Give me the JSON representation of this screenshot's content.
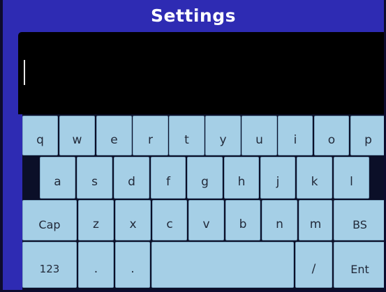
{
  "title": "Settings",
  "text_field": {
    "value": ""
  },
  "keyboard": {
    "row1": [
      "q",
      "w",
      "e",
      "r",
      "t",
      "y",
      "u",
      "i",
      "o",
      "p"
    ],
    "row2": [
      "a",
      "s",
      "d",
      "f",
      "g",
      "h",
      "j",
      "k",
      "l"
    ],
    "row3": [
      "Cap",
      "z",
      "x",
      "c",
      "v",
      "b",
      "n",
      "m",
      "BS"
    ],
    "row4": [
      "123",
      ".",
      ".",
      "",
      "/",
      "Ent"
    ]
  }
}
